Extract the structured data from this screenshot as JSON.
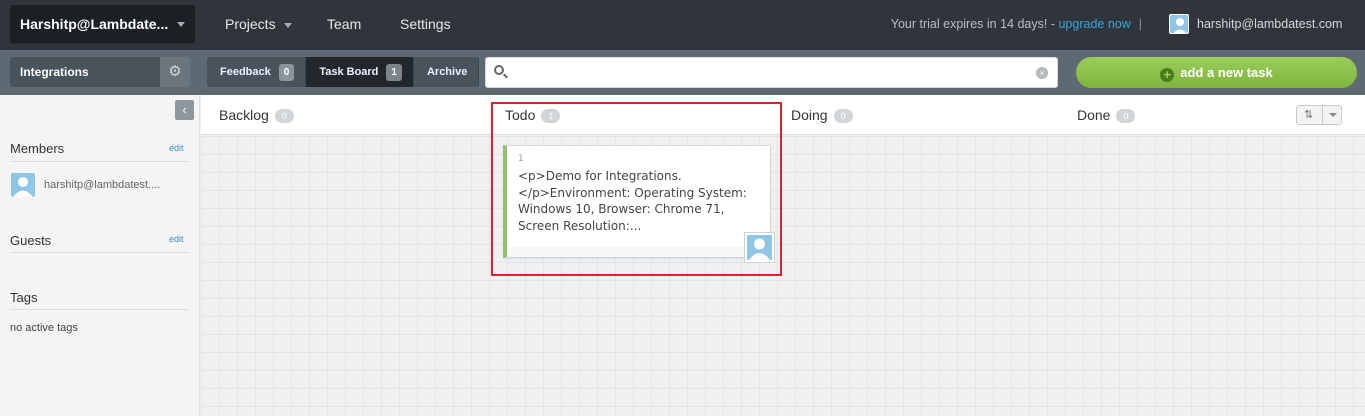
{
  "topbar": {
    "account_label": "Harshitp@Lambdate...",
    "nav": [
      "Projects",
      "Team",
      "Settings"
    ],
    "trial_text": "Your trial expires in 14 days! - ",
    "upgrade_link": "upgrade now",
    "separator": "|",
    "user_email": "harshitp@lambdatest.com"
  },
  "subbar": {
    "project_name": "Integrations",
    "tabs": [
      {
        "label": "Feedback",
        "count": "0"
      },
      {
        "label": "Task Board",
        "count": "1"
      },
      {
        "label": "Archive"
      }
    ],
    "search_value": "",
    "add_task_label": "add a new task"
  },
  "sidebar": {
    "members_title": "Members",
    "guests_title": "Guests",
    "tags_title": "Tags",
    "edit_label": "edit",
    "member_name": "harshitp@lambdatest....",
    "no_tags": "no active tags"
  },
  "board": {
    "columns": [
      {
        "name": "Backlog",
        "count": "0"
      },
      {
        "name": "Todo",
        "count": "1"
      },
      {
        "name": "Doing",
        "count": "0"
      },
      {
        "name": "Done",
        "count": "0"
      }
    ],
    "card": {
      "id": "1",
      "text": "<p>Demo for Integrations.</p>Environment: Operating System: Windows 10, Browser: Chrome 71, Screen Resolution:..."
    }
  },
  "colors": {
    "topbar": "#30343b",
    "subbar": "#5e6a73",
    "accent_green": "#8bc34a",
    "highlight_red": "#d9232e",
    "link_blue": "#38a6e0"
  }
}
